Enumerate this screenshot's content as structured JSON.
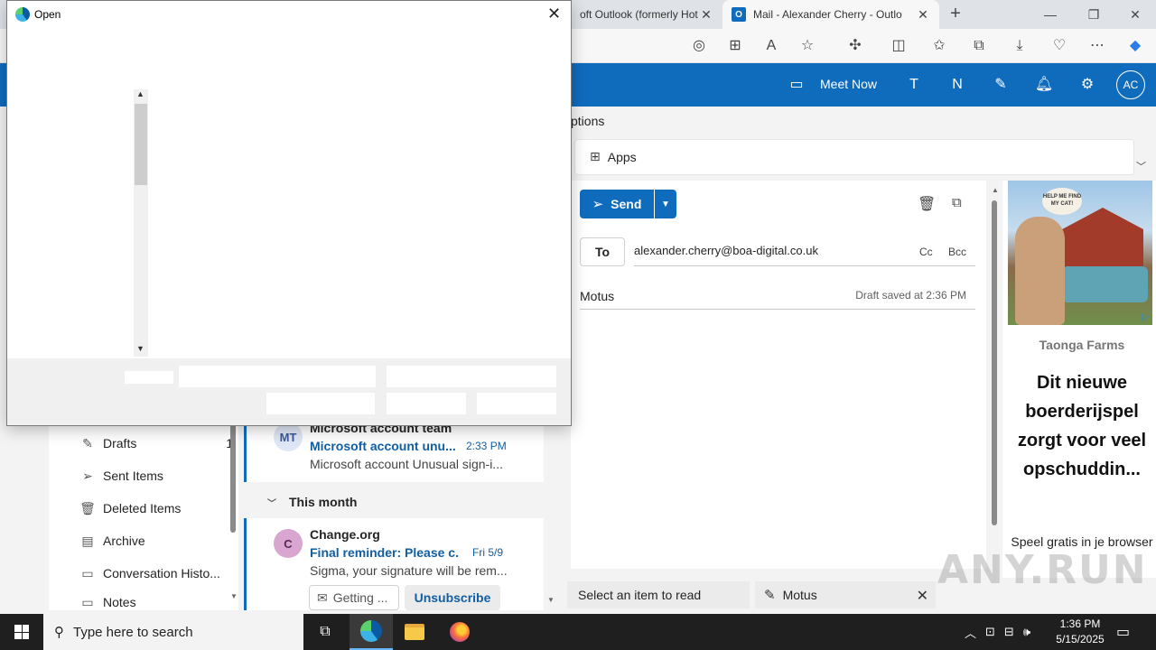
{
  "browser": {
    "tabs": [
      {
        "title": "oft Outlook (formerly Hot",
        "active": false
      },
      {
        "title": "Mail - Alexander Cherry - Outlo",
        "active": true
      }
    ],
    "icons": [
      "tracking-icon",
      "extensions-icon",
      "read-aloud-icon",
      "favorite-icon",
      "puzzle-icon",
      "split-screen-icon",
      "favorites-icon",
      "collections-icon",
      "downloads-icon",
      "performance-icon",
      "more-icon",
      "copilot-icon"
    ]
  },
  "outlook": {
    "header": {
      "meet_now": "Meet Now",
      "avatar_initials": "AC"
    },
    "ribbon": {
      "options_tab": "ptions",
      "apps_label": "Apps"
    },
    "folders": [
      {
        "label": "Drafts",
        "count": "1",
        "icon": "pencil-icon"
      },
      {
        "label": "Sent Items",
        "count": "",
        "icon": "send-icon"
      },
      {
        "label": "Deleted Items",
        "count": "",
        "icon": "trash-icon"
      },
      {
        "label": "Archive",
        "count": "",
        "icon": "archive-icon"
      },
      {
        "label": "Conversation Histo...",
        "count": "",
        "icon": "folder-icon"
      },
      {
        "label": "Notes",
        "count": "",
        "icon": "notes-icon"
      }
    ],
    "messages": [
      {
        "initials": "MT",
        "sender": "Microsoft account team",
        "subject": "Microsoft account unu...",
        "time": "2:33 PM",
        "preview": "Microsoft account Unusual sign-i..."
      },
      {
        "initials": "C",
        "sender": "Change.org",
        "subject": "Final reminder: Please c...",
        "time": "Fri 5/9",
        "preview": "Sigma, your signature will be rem..."
      }
    ],
    "group_header": "This month",
    "chips": {
      "getting": "Getting ...",
      "unsubscribe": "Unsubscribe"
    },
    "compose": {
      "send_label": "Send",
      "to_label": "To",
      "to_value": "alexander.cherry@boa-digital.co.uk",
      "cc_label": "Cc",
      "bcc_label": "Bcc",
      "subject": "Motus",
      "draft_saved": "Draft saved at 2:36 PM"
    },
    "ad": {
      "sign_text": "HELP ME FIND MY CAT!",
      "brand": "Taonga Farms",
      "headline": "Dit nieuwe boerderijspel zorgt voor veel opschuddin...",
      "cta": "Speel gratis in je browser"
    },
    "bottom": {
      "select_item": "Select an item to read",
      "draft_tab": "Motus"
    }
  },
  "dialog": {
    "title": "Open"
  },
  "taskbar": {
    "search_placeholder": "Type here to search",
    "time": "1:36 PM",
    "date": "5/15/2025"
  },
  "watermark": "ANY.RUN",
  "colors": {
    "outlook_blue": "#0f6cbd",
    "link_blue": "#115ea3",
    "taskbar": "#1f1f1f"
  }
}
